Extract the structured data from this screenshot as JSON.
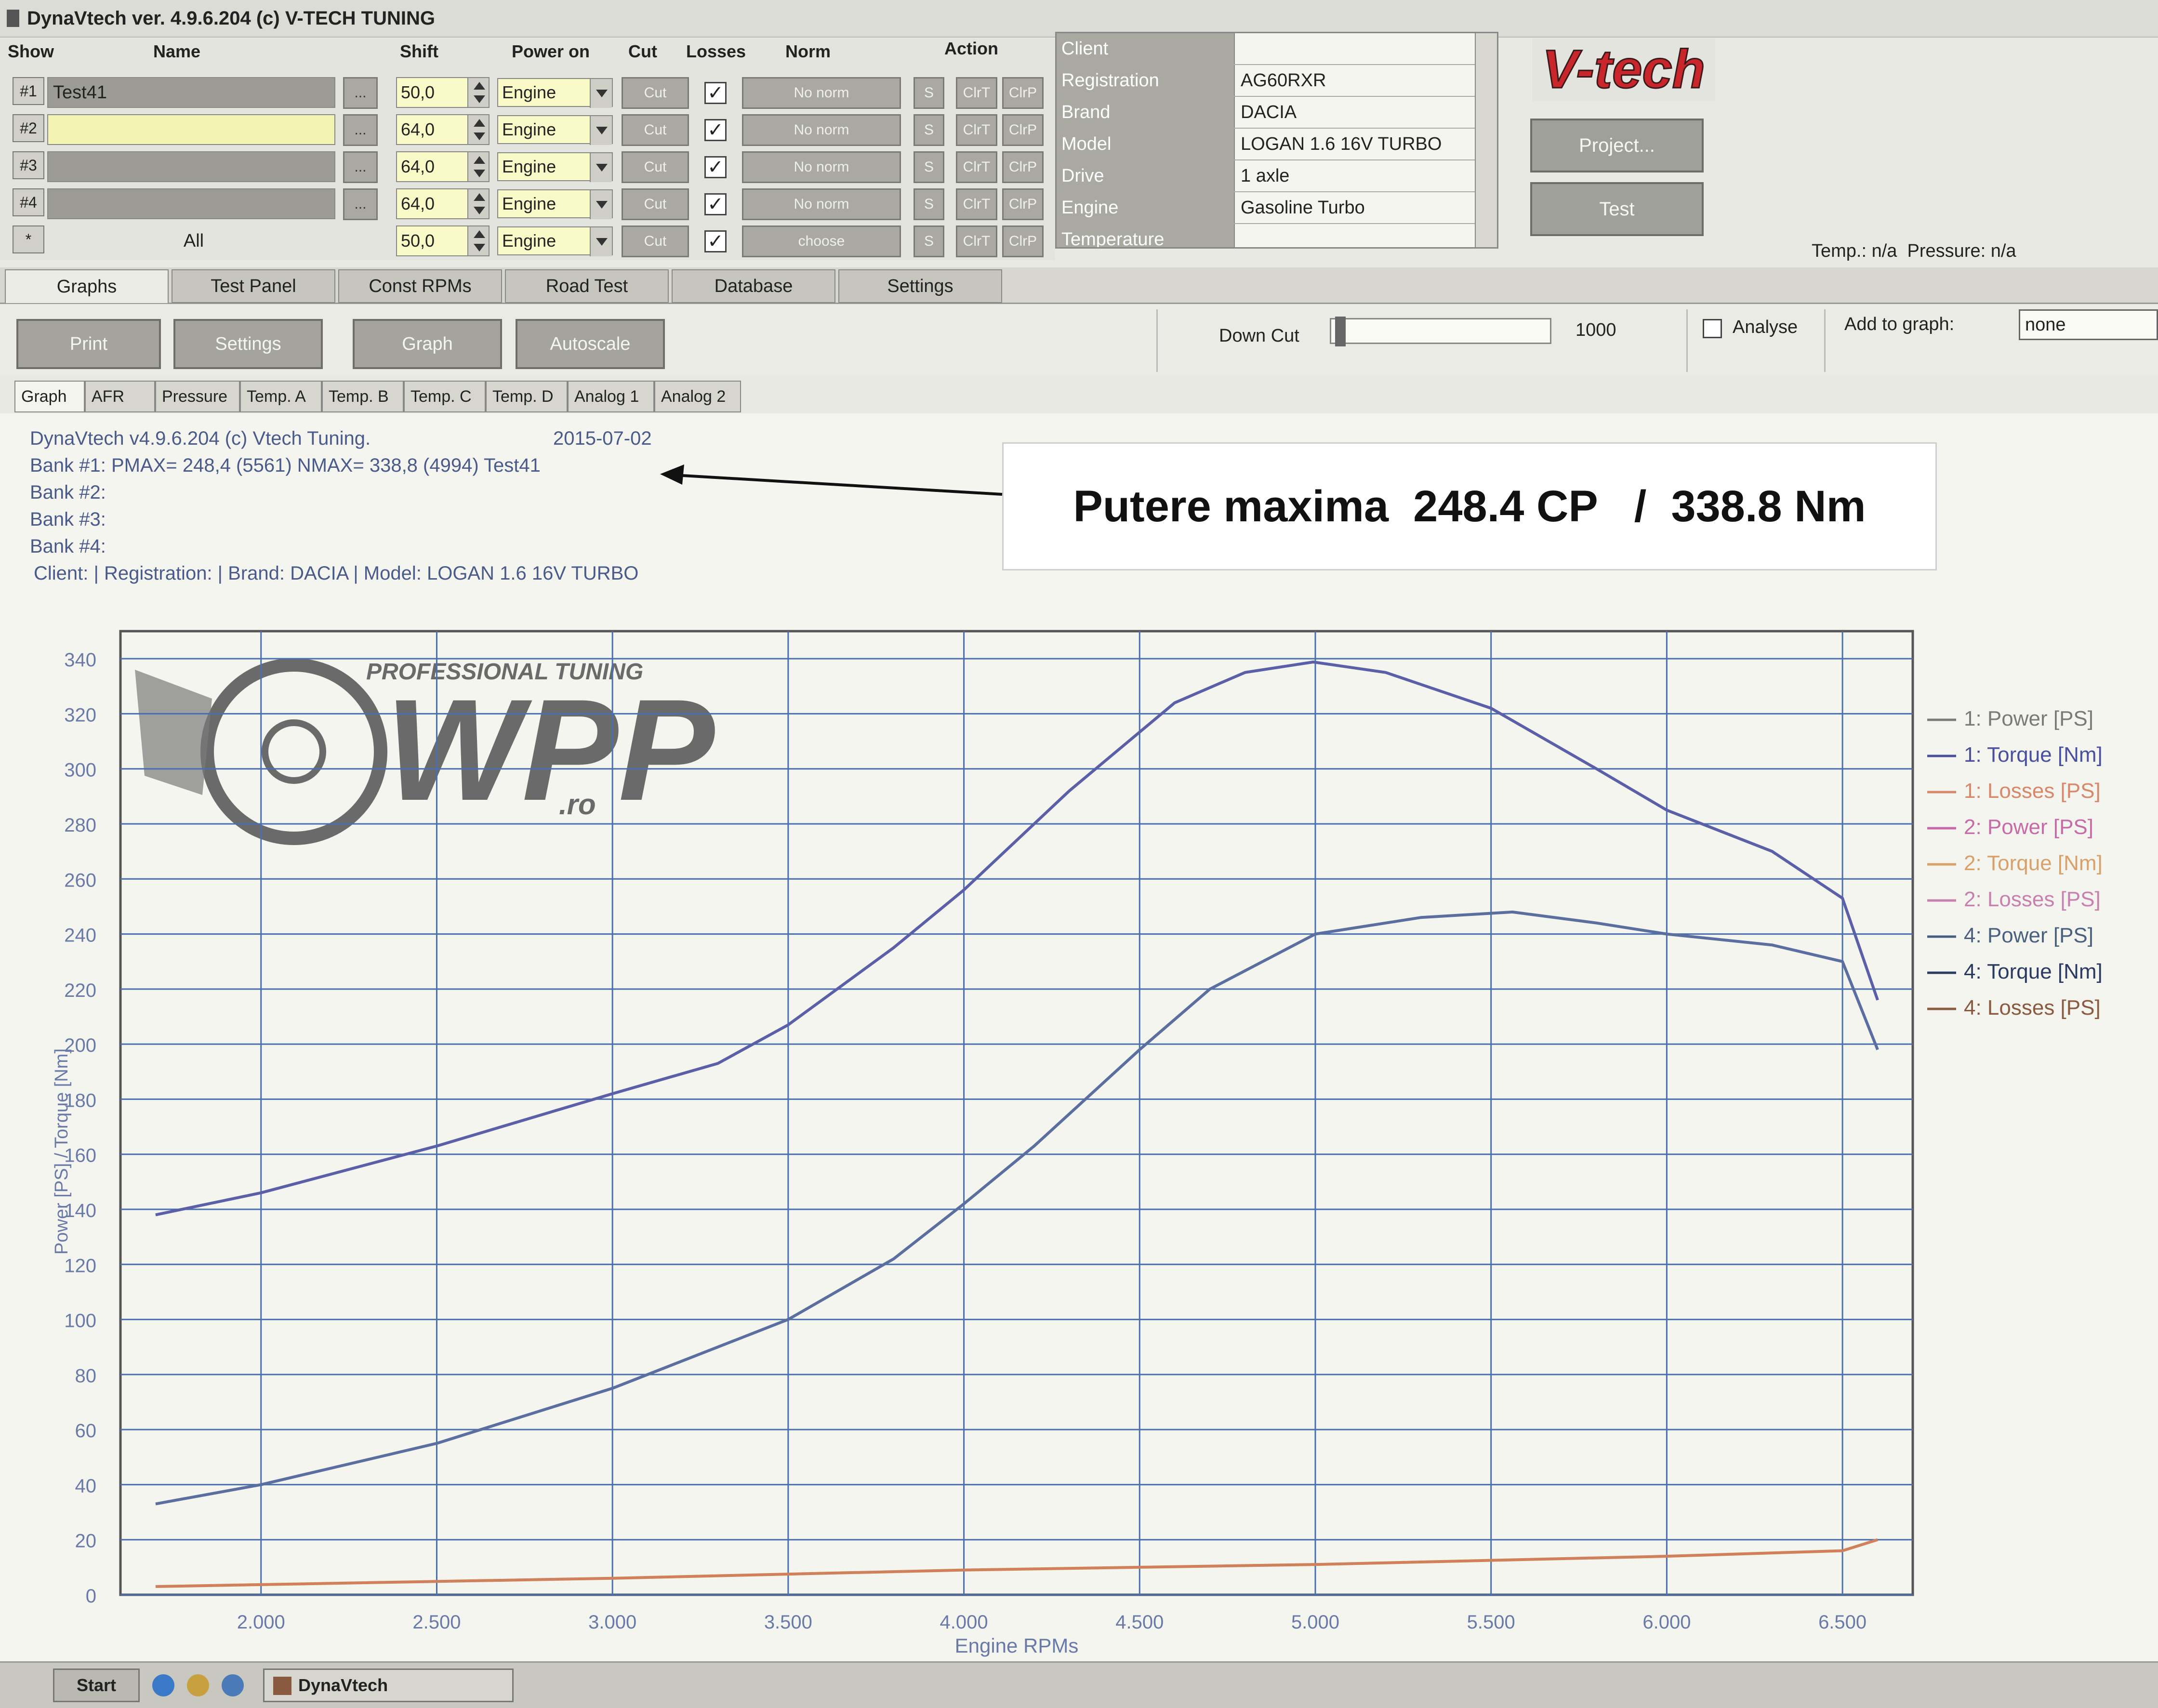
{
  "window": {
    "title": "DynaVtech ver. 4.9.6.204 (c) V-TECH TUNING"
  },
  "columns": {
    "show": "Show",
    "name": "Name",
    "shift": "Shift",
    "power_on": "Power on",
    "cut": "Cut",
    "losses": "Losses",
    "norm": "Norm",
    "action": "Action"
  },
  "rows": [
    {
      "tag": "#1",
      "name": "Test41",
      "shift": "50,0",
      "power_on": "Engine",
      "cut": "Cut",
      "losses": "✓",
      "norm": "No norm",
      "s": "S",
      "clrt": "ClrT",
      "clrp": "ClrP"
    },
    {
      "tag": "#2",
      "name": "",
      "shift": "64,0",
      "power_on": "Engine",
      "cut": "Cut",
      "losses": "✓",
      "norm": "No norm",
      "s": "S",
      "clrt": "ClrT",
      "clrp": "ClrP"
    },
    {
      "tag": "#3",
      "name": "",
      "shift": "64,0",
      "power_on": "Engine",
      "cut": "Cut",
      "losses": "✓",
      "norm": "No norm",
      "s": "S",
      "clrt": "ClrT",
      "clrp": "ClrP"
    },
    {
      "tag": "#4",
      "name": "",
      "shift": "64,0",
      "power_on": "Engine",
      "cut": "Cut",
      "losses": "✓",
      "norm": "No norm",
      "s": "S",
      "clrt": "ClrT",
      "clrp": "ClrP"
    },
    {
      "tag": "*",
      "name": "All",
      "shift": "50,0",
      "power_on": "Engine",
      "cut": "Cut",
      "losses": "✓",
      "norm": "choose",
      "s": "S",
      "clrt": "ClrT",
      "clrp": "ClrP"
    }
  ],
  "ellipsis": "...",
  "client_table": [
    {
      "key": "Client",
      "value": ""
    },
    {
      "key": "Registration",
      "value": "AG60RXR"
    },
    {
      "key": "Brand",
      "value": "DACIA"
    },
    {
      "key": "Model",
      "value": "LOGAN 1.6 16V TURBO"
    },
    {
      "key": "Drive",
      "value": "1 axle"
    },
    {
      "key": "Engine",
      "value": "Gasoline Turbo"
    },
    {
      "key": "Temperature",
      "value": ""
    }
  ],
  "logo_text": "V-tech",
  "buttons": {
    "project": "Project...",
    "test": "Test"
  },
  "status": {
    "temp": "Temp.: n/a",
    "pressure": "Pressure: n/a"
  },
  "main_tabs": [
    "Graphs",
    "Test Panel",
    "Const RPMs",
    "Road Test",
    "Database",
    "Settings"
  ],
  "toolbar": {
    "print": "Print",
    "settings": "Settings",
    "graph": "Graph",
    "autoscale": "Autoscale",
    "down_cut_label": "Down Cut",
    "down_cut_value": "1000",
    "analyse": "Analyse",
    "add_to_graph": "Add to graph:",
    "add_to_graph_value": "none"
  },
  "sub_tabs": [
    "Graph",
    "AFR",
    "Pressure",
    "Temp. A",
    "Temp. B",
    "Temp. C",
    "Temp. D",
    "Analog 1",
    "Analog 2"
  ],
  "info": {
    "line1": "DynaVtech v4.9.6.204 (c) Vtech Tuning.",
    "date": "2015-07-02",
    "bank1": "Bank #1:  PMAX= 248,4 (5561)    NMAX= 338,8 (4994)   Test41",
    "bank2": "Bank #2:",
    "bank3": "Bank #3:",
    "bank4": "Bank #4:",
    "client": "Client:  | Registration:            | Brand: DACIA | Model: LOGAN 1.6 16V TURBO"
  },
  "annotation": "Putere maxima  248.4 CP   /  338.8 Nm",
  "watermark": {
    "top": "PROFESSIONAL TUNING",
    "main": "WPP",
    "suffix": ".ro"
  },
  "colors": {
    "torque": "#5a5fa8",
    "power": "#5a6ea0",
    "losses": "#d0805a",
    "grid": "#4a6fb0"
  },
  "chart_data": {
    "type": "line",
    "xlabel": "Engine RPMs",
    "ylabel": "Power [PS] / Torque [Nm]",
    "xlim": [
      1600,
      6700
    ],
    "ylim": [
      0,
      350
    ],
    "x_ticks": [
      "2.000",
      "2.500",
      "3.000",
      "3.500",
      "4.000",
      "4.500",
      "5.000",
      "5.500",
      "6.000",
      "6.500"
    ],
    "x_tick_values": [
      2000,
      2500,
      3000,
      3500,
      4000,
      4500,
      5000,
      5500,
      6000,
      6500
    ],
    "y_ticks": [
      0,
      20,
      40,
      60,
      80,
      100,
      120,
      140,
      160,
      180,
      200,
      220,
      240,
      260,
      280,
      300,
      320,
      340
    ],
    "grid": true,
    "legend_position": "right",
    "series": [
      {
        "name": "1: Power [PS]",
        "color": "#5a6ea0",
        "x": [
          1700,
          2000,
          2500,
          3000,
          3500,
          3800,
          4000,
          4200,
          4500,
          4700,
          5000,
          5300,
          5561,
          5800,
          6000,
          6300,
          6500,
          6600
        ],
        "y": [
          33,
          40,
          55,
          75,
          100,
          122,
          142,
          163,
          198,
          220,
          240,
          246,
          248,
          244,
          240,
          236,
          230,
          198
        ]
      },
      {
        "name": "1: Torque [Nm]",
        "color": "#5a5fa8",
        "x": [
          1700,
          2000,
          2500,
          3000,
          3300,
          3500,
          3800,
          4000,
          4300,
          4600,
          4800,
          4994,
          5200,
          5500,
          5800,
          6000,
          6300,
          6500,
          6600
        ],
        "y": [
          138,
          146,
          163,
          182,
          193,
          207,
          235,
          256,
          292,
          324,
          335,
          338.8,
          335,
          322,
          300,
          285,
          270,
          253,
          216
        ]
      },
      {
        "name": "1: Losses [PS]",
        "color": "#d0805a",
        "x": [
          1700,
          3000,
          4000,
          5000,
          6000,
          6500,
          6600
        ],
        "y": [
          3,
          6,
          9,
          11,
          14,
          16,
          20
        ]
      }
    ],
    "legend_entries": [
      {
        "label": "1: Power [PS]",
        "color": "#7a7a7a"
      },
      {
        "label": "1: Torque [Nm]",
        "color": "#4a4fa0"
      },
      {
        "label": "1: Losses [PS]",
        "color": "#d8876a"
      },
      {
        "label": "2: Power [PS]",
        "color": "#c86aa8"
      },
      {
        "label": "2: Torque [Nm]",
        "color": "#d8a06a"
      },
      {
        "label": "2: Losses [PS]",
        "color": "#c880b0"
      },
      {
        "label": "4: Power [PS]",
        "color": "#4a6080"
      },
      {
        "label": "4: Torque [Nm]",
        "color": "#2a3a60"
      },
      {
        "label": "4: Losses [PS]",
        "color": "#8a5a40"
      }
    ]
  },
  "taskbar": {
    "start": "Start",
    "task": "DynaVtech"
  }
}
